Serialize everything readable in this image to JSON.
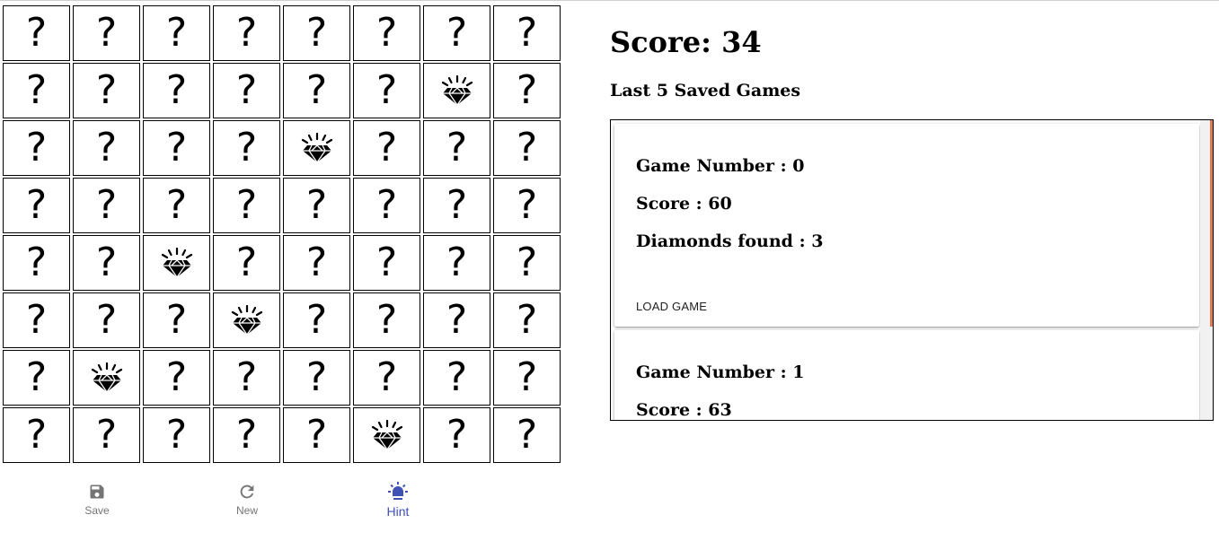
{
  "score_text": "Score: 34",
  "saved_games_title": "Last 5 Saved Games",
  "board": {
    "rows": 8,
    "cols": 8,
    "hidden_symbol": "?",
    "cells": [
      [
        "?",
        "?",
        "?",
        "?",
        "?",
        "?",
        "?",
        "?"
      ],
      [
        "?",
        "?",
        "?",
        "?",
        "?",
        "?",
        "diamond",
        "?"
      ],
      [
        "?",
        "?",
        "?",
        "?",
        "diamond",
        "?",
        "?",
        "?"
      ],
      [
        "?",
        "?",
        "?",
        "?",
        "?",
        "?",
        "?",
        "?"
      ],
      [
        "?",
        "?",
        "diamond",
        "?",
        "?",
        "?",
        "?",
        "?"
      ],
      [
        "?",
        "?",
        "?",
        "diamond",
        "?",
        "?",
        "?",
        "?"
      ],
      [
        "?",
        "diamond",
        "?",
        "?",
        "?",
        "?",
        "?",
        "?"
      ],
      [
        "?",
        "?",
        "?",
        "?",
        "?",
        "diamond",
        "?",
        "?"
      ]
    ]
  },
  "bottom_nav": [
    {
      "label": "Save",
      "icon": "floppy-disk-icon",
      "active": false
    },
    {
      "label": "New",
      "icon": "refresh-icon",
      "active": false
    },
    {
      "label": "Hint",
      "icon": "lightbulb-icon",
      "active": true
    }
  ],
  "saved_games": [
    {
      "game_number": "Game Number : 0",
      "score": "Score : 60",
      "diamonds": "Diamonds found : 3",
      "load_label": "LOAD GAME"
    },
    {
      "game_number": "Game Number : 1",
      "score": "Score : 63"
    }
  ],
  "colors": {
    "accent": "#3f51b5",
    "inactive_nav": "#757575",
    "scroll_thumb": "#e07b53"
  }
}
